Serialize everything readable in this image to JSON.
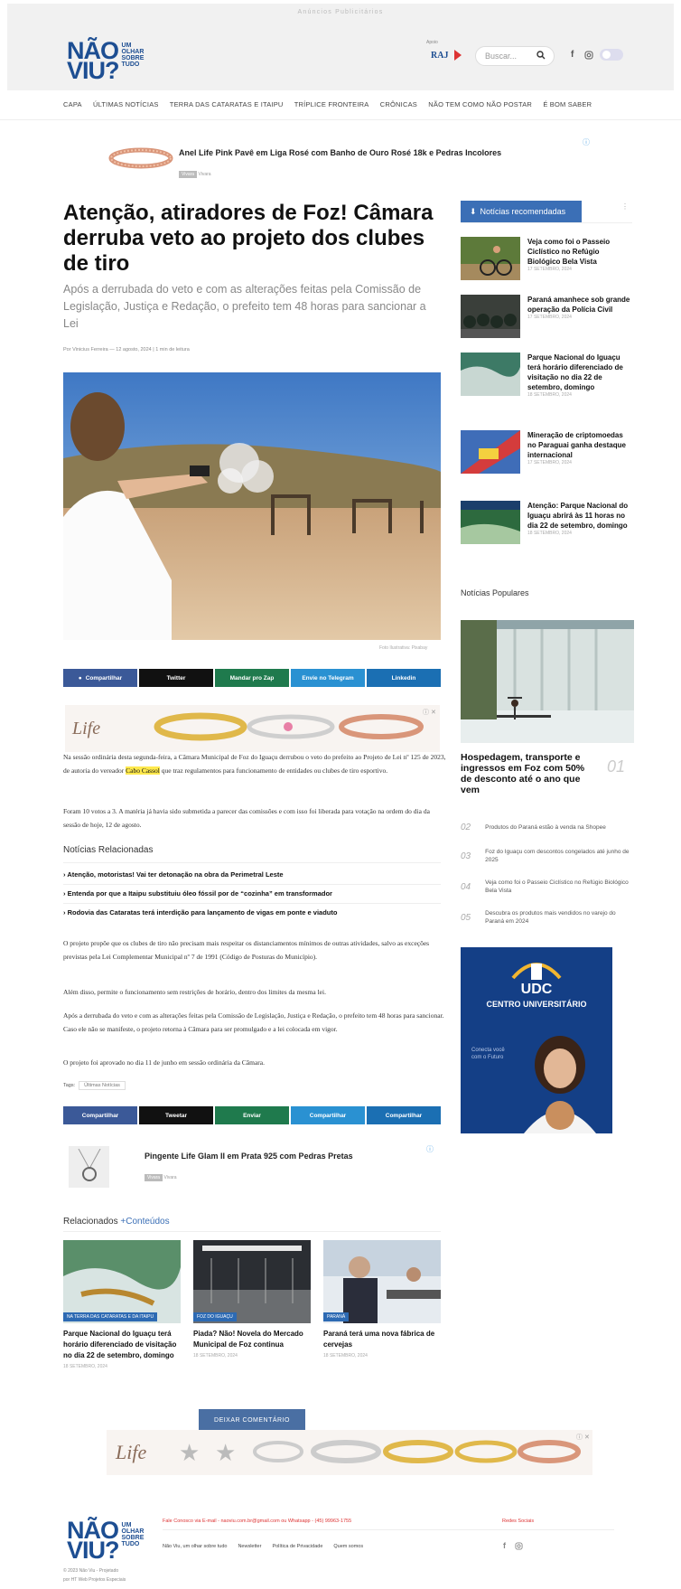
{
  "topbar": {
    "label": "Anúncios Publicitários"
  },
  "logo": {
    "line1": "NÃO",
    "line2": "VIU?",
    "small1": "UM",
    "small2": "OLHAR",
    "small3": "SOBRE",
    "small4": "TUDO"
  },
  "header_sponsor": {
    "label": "Apoio",
    "name": "RAJ"
  },
  "search": {
    "placeholder": "Buscar..."
  },
  "nav": {
    "items": [
      "CAPA",
      "ÚLTIMAS NOTÍCIAS",
      "TERRA DAS CATARATAS E ITAIPU",
      "TRÍPLICE FRONTEIRA",
      "CRÔNICAS",
      "NÃO TEM COMO NÃO POSTAR",
      "É BOM SABER"
    ]
  },
  "ad1": {
    "title": "Anel Life Pink Pavê em Liga Rosé com Banho de Ouro Rosé 18k e Pedras Incolores",
    "tag": "Vivara",
    "source": "Vivara"
  },
  "article": {
    "title": "Atenção, atiradores de Foz! Câmara derruba veto ao projeto dos clubes de tiro",
    "subtitle": "Após a derrubada do veto e com as alterações feitas pela Comissão de Legislação, Justiça e Redação, o prefeito tem 48 horas para sancionar a Lei",
    "byline": "Por Vinicius Ferreira — 12 agosto, 2024 | 1 min de leitura",
    "image_caption": "Foto Ilustrativa: Pixabay",
    "p1_a": "Na sessão ordinária desta segunda-feira, a Câmara Municipal de Foz do Iguaçu derrubou o veto do prefeito ao Projeto de Lei nº 125 de 2023, de autoria do vereador ",
    "p1_highlight": "Cabo Cassol",
    "p1_b": " que traz regulamentos para funcionamento de entidades ou clubes de tiro esportivo.",
    "p2": "Foram 10 votos a 3. A matéria já havia sido submetida a parecer das comissões e com isso foi liberada para votação na ordem do dia da sessão de hoje, 12 de agosto.",
    "related_heading": "Notícias Relacionadas",
    "related": [
      "Atenção, motoristas! Vai ter detonação na obra da Perimetral Leste",
      "Entenda por que a Itaipu substituiu óleo fóssil por de “cozinha” em transformador",
      "Rodovia das Cataratas terá interdição para lançamento de vigas em ponte e viaduto"
    ],
    "p3": "O projeto propõe que os clubes de tiro não precisam mais respeitar os distanciamentos mínimos de outras atividades, salvo as exceções previstas pela Lei Complementar Municipal nº 7 de 1991 (Código de Posturas do Município).",
    "p4": "Além disso, permite o funcionamento sem restrições de horário, dentro dos limites da mesma lei.",
    "p5": "Após a derrubada do veto e com as alterações feitas pela Comissão de Legislação, Justiça e Redação, o prefeito tem 48 horas para sancionar. Caso ele não se manifeste, o projeto retorna à Câmara para ser promulgado e a lei colocada em vigor.",
    "p6": "O projeto foi aprovado no dia 11 de junho em sessão ordinária da Câmara.",
    "tags_label": "Tags:",
    "tag1": "Últimas Notícias"
  },
  "share_top": [
    "Compartilhar",
    "Twitter",
    "Mandar pro Zap",
    "Envie no Telegram",
    "Linkedin"
  ],
  "share_bottom": [
    "Compartilhar",
    "Tweetar",
    "Enviar",
    "Compartilhar",
    "Compartilhar"
  ],
  "ad2": {
    "title": "Pingente Life Glam II em Prata 925 com Pedras Pretas",
    "tag": "Vivara",
    "source": "Vivara"
  },
  "related_section": {
    "heading_a": "Relacionados",
    "heading_b": "+Conteúdos",
    "cards": [
      {
        "badge": "NA TERRA DAS CATARATAS E DA ITAIPU",
        "title": "Parque Nacional do Iguaçu terá horário diferenciado de visitação no dia 22 de setembro, domingo",
        "date": "18 SETEMBRO, 2024"
      },
      {
        "badge": "FOZ DO IGUAÇU",
        "title": "Piada? Não! Novela do Mercado Municipal de Foz continua",
        "date": "18 SETEMBRO, 2024"
      },
      {
        "badge": "PARANÁ",
        "title": "Paraná terá uma nova fábrica de cervejas",
        "date": "18 SETEMBRO, 2024"
      }
    ]
  },
  "comment_button": "DEIXAR COMENTÁRIO",
  "sidebar": {
    "recommended_label": "Notícias recomendadas",
    "recommended": [
      {
        "title": "Veja como foi o Passeio Ciclístico no Refúgio Biológico Bela Vista",
        "date": "17 SETEMBRO, 2024"
      },
      {
        "title": "Paraná amanhece sob grande operação da Polícia Civil",
        "date": "17 SETEMBRO, 2024"
      },
      {
        "title": "Parque Nacional do Iguaçu terá horário diferenciado de visitação no dia 22 de setembro, domingo",
        "date": "18 SETEMBRO, 2024"
      },
      {
        "title": "Mineração de criptomoedas no Paraguai ganha destaque internacional",
        "date": "17 SETEMBRO, 2024"
      },
      {
        "title": "Atenção: Parque Nacional do Iguaçu abrirá às 11 horas no dia 22 de setembro, domingo",
        "date": "18 SETEMBRO, 2024"
      }
    ],
    "popular_label": "Notícias Populares",
    "popular_top": {
      "title": "Hospedagem, transporte e ingressos em Foz com 50% de desconto até o ano que vem",
      "num": "01"
    },
    "popular": [
      {
        "num": "02",
        "title": "Produtos do Paraná estão à venda na Shopee"
      },
      {
        "num": "03",
        "title": "Foz do Iguaçu com descontos congelados até junho de 2025"
      },
      {
        "num": "04",
        "title": "Veja como foi o Passeio Ciclístico no Refúgio Biológico Bela Vista"
      },
      {
        "num": "05",
        "title": "Descubra os produtos mais vendidos no varejo do Paraná em 2024"
      }
    ],
    "udc": {
      "name": "UDC",
      "sub": "CENTRO UNIVERSITÁRIO",
      "slogan": "Conecta você com o Futuro"
    }
  },
  "footer": {
    "contact": "Fale Conosco via E-mail - naoviu.com.br@gmail.com ou Whatsapp - (45) 99963-1755",
    "social_label": "Redes Sociais",
    "links": [
      "Não Viu, um olhar sobre tudo",
      "Newsletter",
      "Política de Privacidade",
      "Quem somos"
    ],
    "copyright1": "© 2023 Não Viu - Projetado",
    "copyright2": "por HT Web Projetos Especiais"
  },
  "colors": {
    "brand": "#1d4e92",
    "accent": "#3b6fb6",
    "whatsapp": "#1f7a4d",
    "telegram": "#2a91d2",
    "linkedin": "#1b6fb3",
    "highlight": "#ffe94d"
  },
  "icons": [
    "search-icon",
    "facebook-icon",
    "instagram-icon",
    "theme-toggle-icon",
    "share-icon",
    "close-icon",
    "info-icon"
  ]
}
